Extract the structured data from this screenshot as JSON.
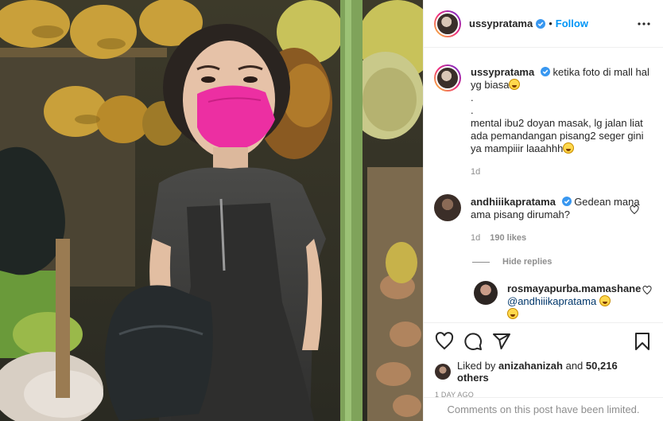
{
  "post": {
    "author": "ussypratama",
    "follow_label": "Follow",
    "separator": "•"
  },
  "caption": {
    "username": "ussypratama",
    "text": "ketika foto di mall hal yg biasa",
    "extra": ".\n.\nmental ibu2 doyan masak, lg jalan liat ada pemandangan pisang2 seger gini ya mampiiir laaahhh",
    "time": "1d"
  },
  "comments": [
    {
      "username": "andhiiikapratama",
      "text": "Gedean mana ama pisang dirumah?",
      "time": "1d",
      "likes": "190 likes"
    }
  ],
  "hide_replies": "Hide replies",
  "reply": {
    "username": "rosmayapurba.mamashane",
    "mention": "@andhiiikapratama"
  },
  "likes": {
    "prefix": "Liked by",
    "user": "anizahanizah",
    "and": "and",
    "count": "50,216 others"
  },
  "posted_ago": "1 DAY AGO",
  "comments_limited": "Comments on this post have been limited.",
  "icons": {
    "more": "more-options-icon",
    "like": "heart-icon",
    "comment": "comment-icon",
    "share": "share-icon",
    "save": "bookmark-icon",
    "verified": "verified-badge-icon"
  },
  "colors": {
    "accent": "#0095f6",
    "verified": "#3897f0",
    "muted": "#8e8e8e",
    "mask": "#ec2fa2"
  }
}
